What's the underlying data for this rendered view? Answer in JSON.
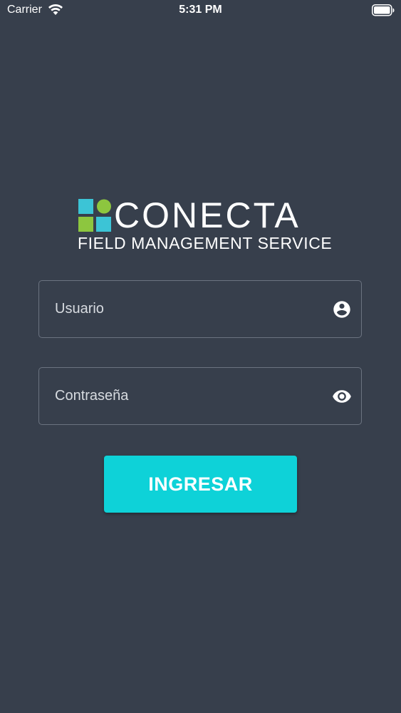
{
  "status_bar": {
    "carrier": "Carrier",
    "time": "5:31 PM",
    "wifi_icon": "wifi-icon",
    "battery_icon": "battery-icon"
  },
  "logo": {
    "wordmark": "CONECTA",
    "tagline": "FIELD MANAGEMENT SERVICE",
    "mark_colors": [
      "#3cc4d6",
      "#8dc63f",
      "#8dc63f",
      "#3cc4d6"
    ]
  },
  "form": {
    "username": {
      "placeholder": "Usuario",
      "value": "",
      "icon": "account-circle-icon"
    },
    "password": {
      "placeholder": "Contraseña",
      "value": "",
      "icon": "eye-icon"
    },
    "submit_label": "INGRESAR"
  },
  "colors": {
    "background": "#373f4c",
    "accent": "#0ed2d8",
    "field_border": "#6b7380"
  }
}
